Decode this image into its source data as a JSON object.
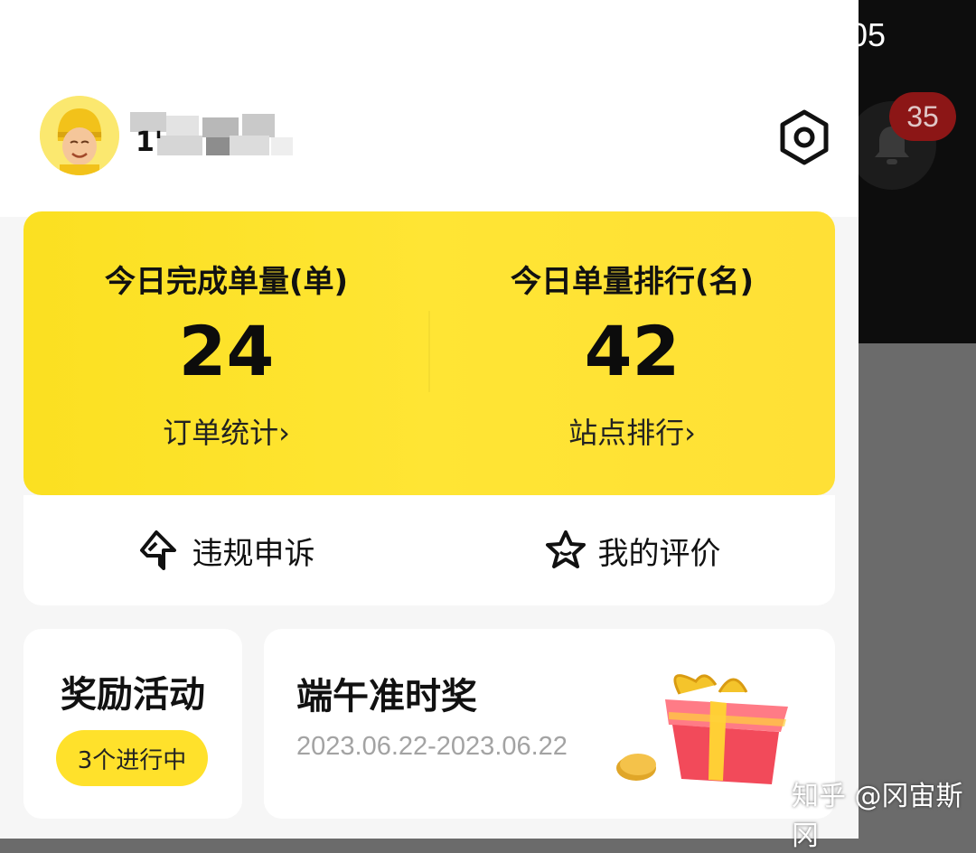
{
  "status_bar": {
    "time_partial": "05"
  },
  "notifications": {
    "count": "35",
    "icon": "bell-icon"
  },
  "profile": {
    "username_visible": "1'",
    "avatar": "courier-avatar",
    "settings_icon": "settings-hexagon-icon"
  },
  "stats": {
    "completed_title": "今日完成单量(单)",
    "completed_value": "24",
    "completed_link": "订单统计",
    "rank_title": "今日单量排行(名)",
    "rank_value": "42",
    "rank_link": "站点排行",
    "chevron": "›"
  },
  "actions": [
    {
      "label": "违规申诉",
      "icon": "appeal-icon"
    },
    {
      "label": "我的评价",
      "icon": "star-face-icon"
    }
  ],
  "rewards": {
    "title": "奖励活动",
    "active_count_label": "3个进行中"
  },
  "event": {
    "title": "端午准时奖",
    "date_range": "2023.06.22-2023.06.22",
    "icon": "gift-box-icon"
  },
  "watermark": "知乎 @冈宙斯冈",
  "colors": {
    "accent_yellow": "#FFE12B",
    "badge_red": "#8C1616",
    "overlay": "#6B6B6B"
  }
}
